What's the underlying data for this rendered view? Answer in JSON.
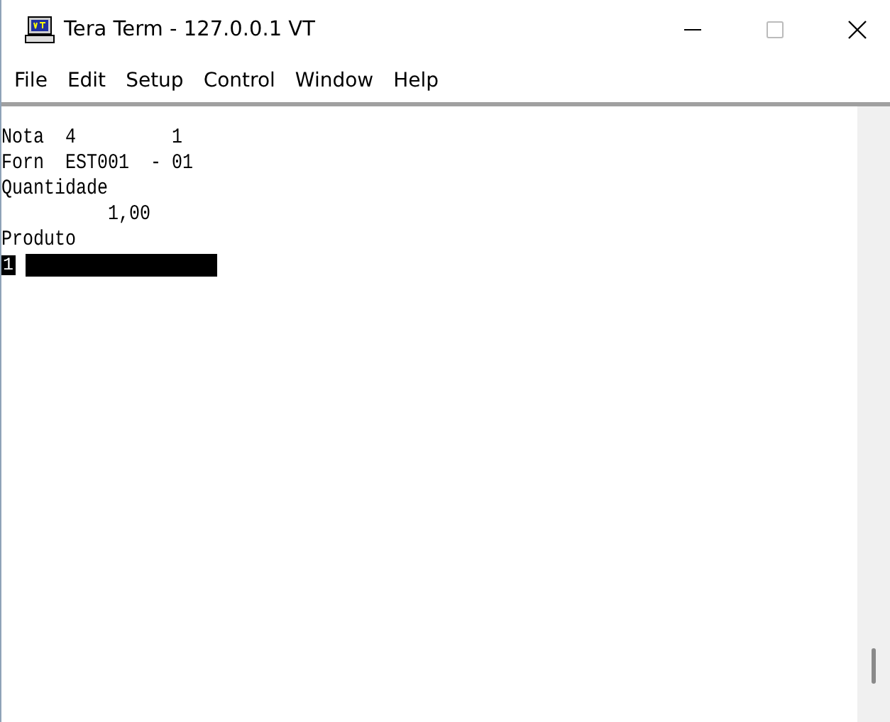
{
  "window": {
    "title": "Tera Term - 127.0.0.1 VT"
  },
  "menu": [
    "File",
    "Edit",
    "Setup",
    "Control",
    "Window",
    "Help"
  ],
  "terminal": {
    "lines": [
      "Nota  4         1",
      "Forn  EST001  - 01",
      "Quantidade",
      "          1,00",
      "Produto"
    ],
    "input_line": {
      "cursor_text": "1"
    }
  }
}
